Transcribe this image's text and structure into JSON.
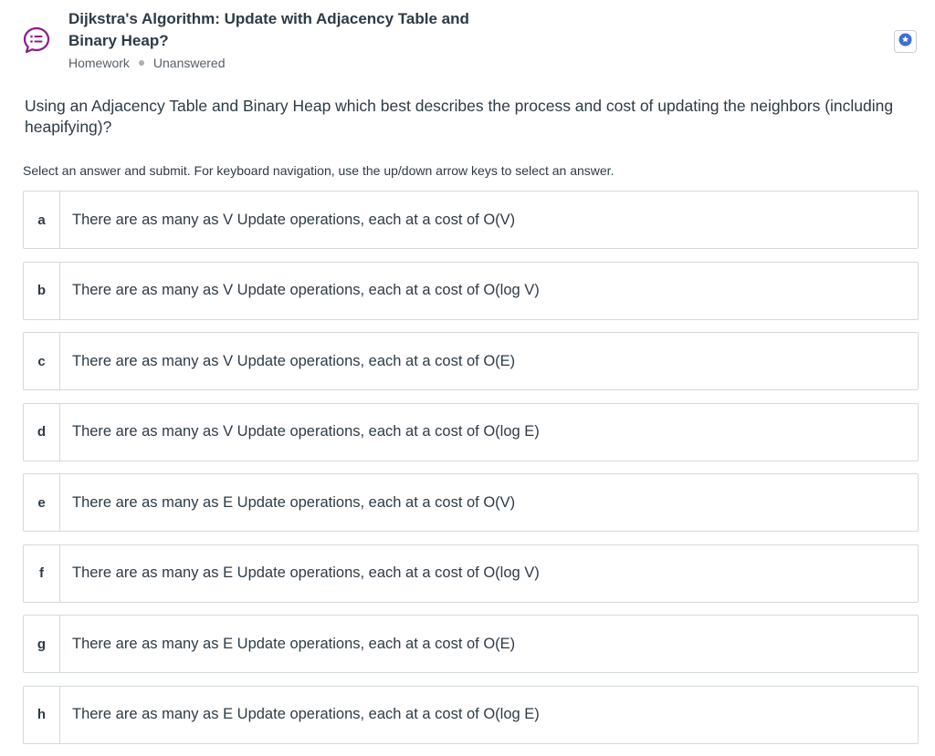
{
  "header": {
    "title": "Dijkstra's Algorithm: Update with Adjacency Table and Binary Heap?",
    "type": "Homework",
    "status": "Unanswered",
    "question_icon": "question-list-icon",
    "bookmark_icon": "star-bookmark-icon",
    "accent_color": "#8c1b8a",
    "bookmark_color": "#3b6fd6"
  },
  "question": {
    "text": "Using an Adjacency Table and Binary Heap which best describes the process and cost of updating the neighbors (including heapifying)?"
  },
  "instructions": "Select an answer and submit. For keyboard navigation, use the up/down arrow keys to select an answer.",
  "options": [
    {
      "letter": "a",
      "text": "There are as many as V Update operations, each at a cost of O(V)"
    },
    {
      "letter": "b",
      "text": "There are as many as V Update operations, each at a cost of O(log V)"
    },
    {
      "letter": "c",
      "text": "There are as many as V Update operations, each at a cost of O(E)"
    },
    {
      "letter": "d",
      "text": "There are as many as V Update operations, each at a cost of O(log E)"
    },
    {
      "letter": "e",
      "text": "There are as many as E Update operations, each at a cost of O(V)"
    },
    {
      "letter": "f",
      "text": "There are as many as E Update operations, each at a cost of O(log V)"
    },
    {
      "letter": "g",
      "text": "There are as many as E Update operations, each at a cost of O(E)"
    },
    {
      "letter": "h",
      "text": "There are as many as E Update operations, each at a cost of O(log E)"
    }
  ]
}
